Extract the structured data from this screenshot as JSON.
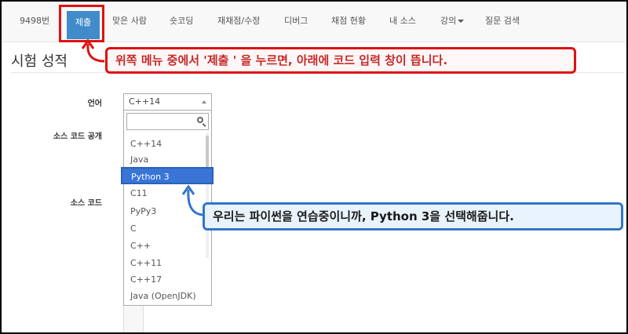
{
  "nav": {
    "problem_id": "9498번",
    "items": [
      {
        "label": "제출"
      },
      {
        "label": "맞은 사람"
      },
      {
        "label": "숏코딩"
      },
      {
        "label": "재채점/수정"
      },
      {
        "label": "디버그"
      },
      {
        "label": "채점 현황"
      },
      {
        "label": "내 소스"
      },
      {
        "label": "강의"
      },
      {
        "label": "질문 검색"
      }
    ]
  },
  "page": {
    "title": "시험 성적"
  },
  "form": {
    "language_label": "언어",
    "source_public_label": "소스 코드 공개",
    "source_code_label": "소스 코드",
    "language_selected": "C++14",
    "search_placeholder": "",
    "options": [
      "C++14",
      "Java",
      "Python 3",
      "C11",
      "PyPy3",
      "C",
      "C++",
      "C++11",
      "C++17",
      "Java (OpenJDK)"
    ]
  },
  "callouts": {
    "submit_note": "위쪽 메뉴 중에서 '제출 ' 을 누르면, 아래에 코드 입력 창이 뜹니다.",
    "python_note": "우리는 파이썬을 연습중이니까, Python 3을 선택해줍니다."
  },
  "colors": {
    "nav_active": "#428bca",
    "red_annotation": "#e01010",
    "blue_annotation": "#3276c8",
    "option_selected": "#3875d7"
  },
  "icons": {
    "search": "search-icon",
    "dropdown_caret": "caret-down-icon",
    "select_arrow": "caret-up-icon"
  }
}
